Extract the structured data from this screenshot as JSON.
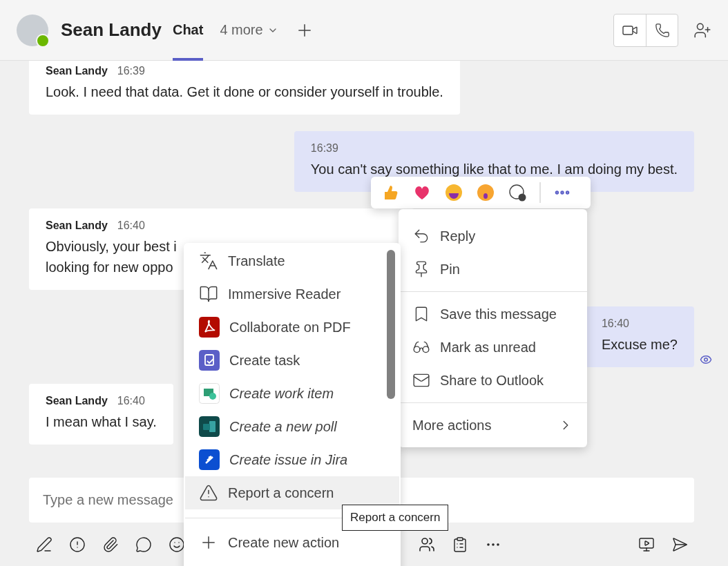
{
  "header": {
    "name": "Sean Landy",
    "available": true,
    "tabs": [
      {
        "label": "Chat",
        "selected": true
      },
      {
        "label": "4 more",
        "selected": false
      }
    ]
  },
  "messages": [
    {
      "kind": "incoming",
      "sender": "Sean Landy",
      "time": "16:39",
      "lines": [
        "Look. I need that data. Get it done or consider yourself in trouble."
      ],
      "seen": false
    },
    {
      "kind": "outgoing",
      "time": "16:39",
      "lines": [
        "You can't say something like that to me. I am doing my best."
      ],
      "seen": false
    },
    {
      "kind": "incoming",
      "sender": "Sean Landy",
      "time": "16:40",
      "lines": [
        "Obviously, your best i",
        "looking for new oppo"
      ],
      "seen": false
    },
    {
      "kind": "outgoing",
      "time": "16:40",
      "lines": [
        "Excuse me?"
      ],
      "seen": true
    },
    {
      "kind": "incoming",
      "sender": "Sean Landy",
      "time": "16:40",
      "lines": [
        "I mean what I say."
      ],
      "seen": false
    }
  ],
  "message_actions": {
    "groups": [
      [
        {
          "label": "Reply",
          "kind": "reply"
        },
        {
          "label": "Pin",
          "kind": "pin"
        }
      ],
      [
        {
          "label": "Save this message",
          "kind": "save"
        },
        {
          "label": "Mark as unread",
          "kind": "unread"
        },
        {
          "label": "Share to Outlook",
          "kind": "mail"
        }
      ],
      [
        {
          "label": "More actions",
          "kind": "submenu"
        }
      ]
    ]
  },
  "more_actions": {
    "items": [
      {
        "label": "Translate",
        "kind": "translate",
        "italic": false,
        "hovered": false
      },
      {
        "label": "Immersive Reader",
        "kind": "reader",
        "italic": false,
        "hovered": false
      },
      {
        "label": "Collaborate on PDF",
        "kind": "pdf",
        "italic": false,
        "hovered": false
      },
      {
        "label": "Create task",
        "kind": "task",
        "italic": false,
        "hovered": false
      },
      {
        "label": "Create work item",
        "kind": "workitem",
        "italic": true,
        "hovered": false
      },
      {
        "label": "Create a new poll",
        "kind": "poll",
        "italic": true,
        "hovered": false
      },
      {
        "label": "Create issue in Jira",
        "kind": "jira",
        "italic": true,
        "hovered": false
      },
      {
        "label": "Report a concern",
        "kind": "warning",
        "italic": false,
        "hovered": true
      }
    ],
    "footer": {
      "label": "Create new action"
    }
  },
  "tooltip": "Report a concern",
  "compose": {
    "placeholder": "Type a new message"
  }
}
